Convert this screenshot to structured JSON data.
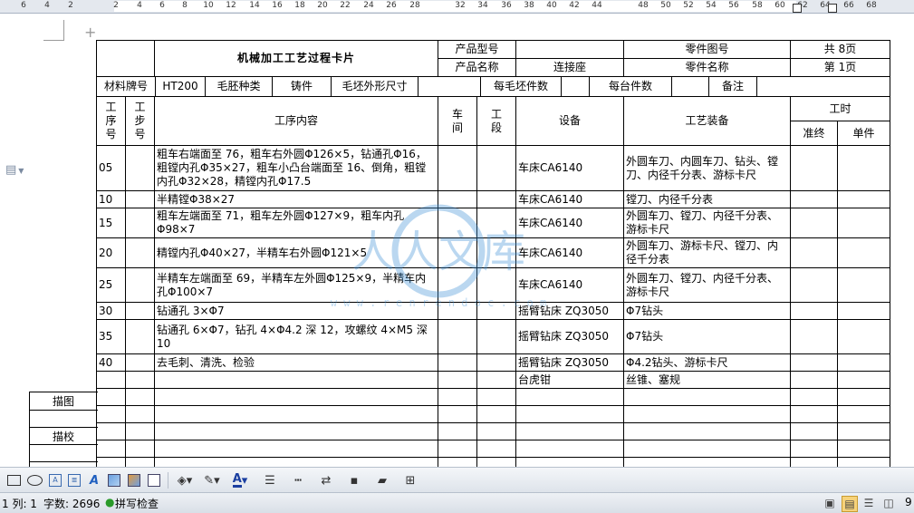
{
  "ruler": {
    "numbers": [
      "6",
      "4",
      "2",
      "2",
      "4",
      "6",
      "8",
      "10",
      "12",
      "14",
      "16",
      "18",
      "20",
      "22",
      "24",
      "26",
      "28",
      "32",
      "34",
      "36",
      "38",
      "40",
      "42",
      "44",
      "48",
      "50",
      "52",
      "54",
      "56",
      "58",
      "60",
      "62",
      "64",
      "66",
      "68"
    ]
  },
  "card": {
    "title": "机械加工工艺过程卡片",
    "product_model_label": "产品型号",
    "product_model_value": "",
    "part_drawing_label": "零件图号",
    "part_drawing_value": "",
    "total_pages": "共 8页",
    "product_name_label": "产品名称",
    "product_name_value": "连接座",
    "part_name_label": "零件名称",
    "part_name_value": "连接座",
    "page_number": "第 1页",
    "material_label": "材料牌号",
    "material_value": "HT200",
    "blank_type_label": "毛胚种类",
    "blank_type_value": "铸件",
    "blank_size_label": "毛坯外形尺寸",
    "blank_size_value": "",
    "parts_per_blank_label": "每毛坯件数",
    "parts_per_blank_value": "",
    "parts_per_unit_label": "每台件数",
    "parts_per_unit_value": "",
    "remarks_label": "备注",
    "remarks_value": "",
    "headers": {
      "process_no": "工\n序\n号",
      "step_no": "工\n步\n号",
      "content": "工序内容",
      "workshop": "车\n间",
      "section": "工\n段",
      "equipment": "设备",
      "tooling": "工艺装备",
      "time": "工时",
      "prep_time": "准终",
      "unit_time": "单件"
    },
    "rows": [
      {
        "no": "05",
        "content": "粗车右端面至 76，粗车右外圆Φ126×5，钻通孔Φ16，粗镗内孔Φ35×27，粗车小凸台端面至 16、倒角，粗镗内孔Φ32×28，精镗内孔Φ17.5",
        "equipment": "车床CA6140",
        "tooling": "外圆车刀、内圆车刀、钻头、镗刀、内径千分表、游标卡尺"
      },
      {
        "no": "10",
        "content": "半精镗Φ38×27",
        "equipment": "车床CA6140",
        "tooling": "镗刀、内径千分表"
      },
      {
        "no": "15",
        "content": "粗车左端面至 71，粗车左外圆Φ127×9，粗车内孔Φ98×7",
        "equipment": "车床CA6140",
        "tooling": "外圆车刀、镗刀、内径千分表、游标卡尺"
      },
      {
        "no": "20",
        "content": "精镗内孔Φ40×27，半精车右外圆Φ121×5",
        "equipment": "车床CA6140",
        "tooling": "外圆车刀、游标卡尺、镗刀、内径千分表"
      },
      {
        "no": "25",
        "content": "半精车左端面至 69，半精车左外圆Φ125×9，半精车内孔Φ100×7",
        "equipment": "车床CA6140",
        "tooling": "外圆车刀、镗刀、内径千分表、游标卡尺"
      },
      {
        "no": "30",
        "content": "钻通孔 3×Φ7",
        "equipment": "摇臂钻床 ZQ3050",
        "tooling": "Φ7钻头"
      },
      {
        "no": "35",
        "content": "钻通孔 6×Φ7，钻孔 4×Φ4.2 深 12，攻螺纹 4×M5 深 10",
        "equipment": "摇臂钻床 ZQ3050",
        "tooling": "Φ7钻头"
      },
      {
        "no": "40",
        "content": "去毛刺、清洗、检验",
        "equipment": "摇臂钻床 ZQ3050",
        "tooling": "Φ4.2钻头、游标卡尺"
      },
      {
        "no": "",
        "content": "",
        "equipment": "台虎钳",
        "tooling": "丝锥、塞规"
      }
    ],
    "sign_labels": {
      "drawing": "描图",
      "verify": "描校"
    }
  },
  "watermark": {
    "brand": "人人文库",
    "url": "w w w . r e n r e n d o c . c o m"
  },
  "status": {
    "line_col": "1 列: 1",
    "word_count": "字数: 2696",
    "spell_check": "拼写检查",
    "zoom": "9"
  },
  "colors": {
    "watermark": "#3b8fd6",
    "toolbar_bg": "#e6eaf0"
  }
}
